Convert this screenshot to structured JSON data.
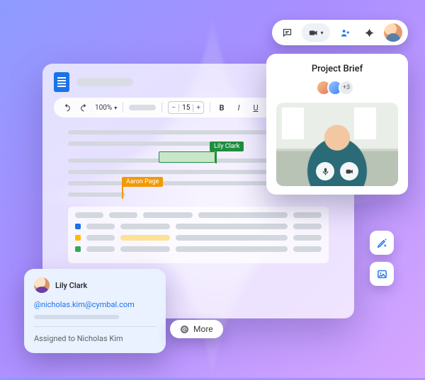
{
  "toolbar": {
    "zoom": "100%",
    "font_size": "15"
  },
  "collaborators": {
    "user_a": {
      "name": "Lily Clark",
      "color": "#1e8e3e"
    },
    "user_b": {
      "name": "Aaron Page",
      "color": "#f29900"
    }
  },
  "meet": {
    "title": "Project Brief",
    "overflow_count": "+3"
  },
  "comment": {
    "author": "Lily Clark",
    "mention_email": "nicholas.kim@cymbal.com",
    "assigned_text": "Assigned to Nicholas Kim"
  },
  "more_button": {
    "label": "More"
  },
  "icons": {
    "undo": "undo",
    "redo": "redo",
    "link": "link",
    "image": "image",
    "mic": "mic",
    "video": "video",
    "chat": "chat",
    "gemini": "gemini",
    "people": "people",
    "pen": "pen",
    "img_insert": "image-insert",
    "at": "at"
  }
}
